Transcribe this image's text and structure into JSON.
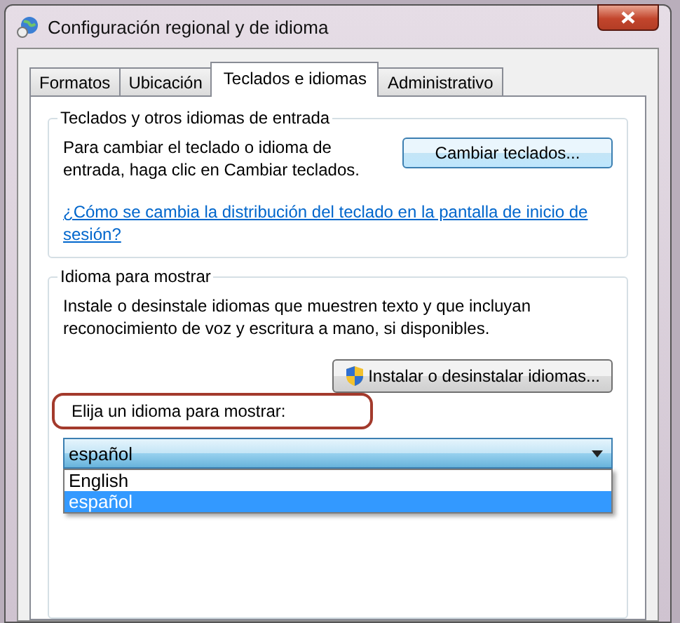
{
  "window": {
    "title": "Configuración regional y de idioma"
  },
  "tabs": [
    {
      "label": "Formatos",
      "selected": false
    },
    {
      "label": "Ubicación",
      "selected": false
    },
    {
      "label": "Teclados e idiomas",
      "selected": true
    },
    {
      "label": "Administrativo",
      "selected": false
    }
  ],
  "keyboards_group": {
    "legend": "Teclados y otros idiomas de entrada",
    "text": "Para cambiar el teclado o idioma de entrada, haga clic en Cambiar teclados.",
    "button": "Cambiar teclados...",
    "link": "¿Cómo se cambia la distribución del teclado en la pantalla de inicio de sesión?"
  },
  "display_group": {
    "legend": "Idioma para mostrar",
    "text": "Instale o desinstale idiomas que muestren texto y que incluyan reconocimiento de voz y escritura a mano, si disponibles.",
    "button": "Instalar o desinstalar idiomas...",
    "prompt": {
      "text": "Elija un idioma para mostrar:",
      "highlighted": true
    },
    "dropdown": {
      "value": "español",
      "expanded": true,
      "options": [
        {
          "label": "English",
          "selected": false
        },
        {
          "label": "español",
          "selected": true
        }
      ]
    }
  }
}
